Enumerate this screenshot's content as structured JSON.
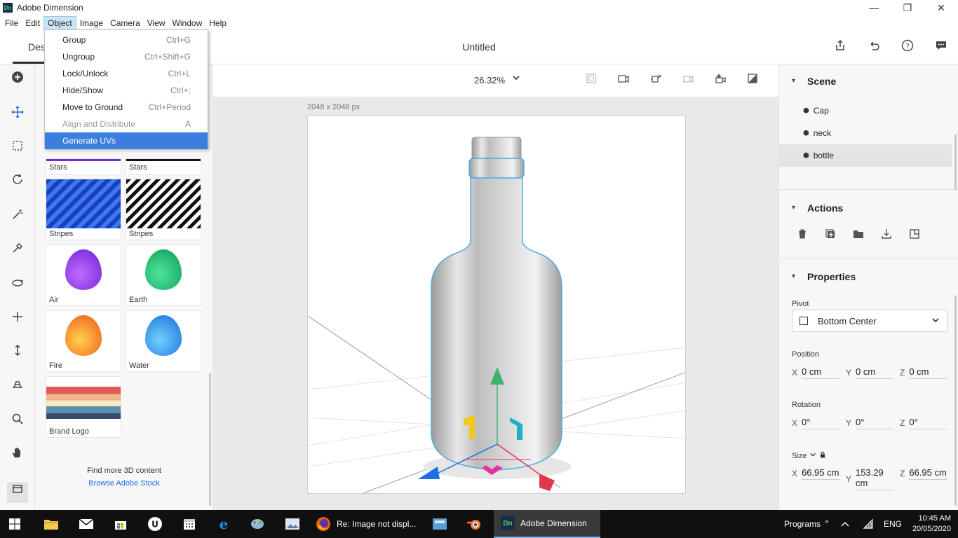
{
  "window": {
    "app_icon": "Dn",
    "title": "Adobe Dimension",
    "minimize": "—",
    "maximize": "❐",
    "close": "✕"
  },
  "menu": [
    "File",
    "Edit",
    "Object",
    "Image",
    "Camera",
    "View",
    "Window",
    "Help"
  ],
  "object_menu": [
    {
      "label": "Group",
      "shortcut": "Ctrl+G"
    },
    {
      "label": "Ungroup",
      "shortcut": "Ctrl+Shift+G"
    },
    {
      "label": "Lock/Unlock",
      "shortcut": "Ctrl+L"
    },
    {
      "label": "Hide/Show",
      "shortcut": "Ctrl+;"
    },
    {
      "label": "Move to Ground",
      "shortcut": "Ctrl+Period"
    },
    {
      "label": "Align and Distribute",
      "shortcut": "A"
    },
    {
      "label": "Generate UVs",
      "shortcut": ""
    }
  ],
  "header": {
    "tab_design": "Desi",
    "doc_title": "Untitled"
  },
  "assets": {
    "tiles": [
      {
        "label": "Stars"
      },
      {
        "label": "Stars"
      },
      {
        "label": "Stripes"
      },
      {
        "label": "Stripes"
      },
      {
        "label": "Air"
      },
      {
        "label": "Earth"
      },
      {
        "label": "Fire"
      },
      {
        "label": "Water"
      },
      {
        "label": "Brand Logo"
      }
    ],
    "find_more": "Find more 3D content",
    "browse": "Browse Adobe Stock"
  },
  "viewport": {
    "zoom": "26.32%",
    "canvas_size": "2048 x 2048 px"
  },
  "scene": {
    "title": "Scene",
    "items": [
      {
        "label": "Cap"
      },
      {
        "label": "neck"
      },
      {
        "label": "bottle"
      }
    ]
  },
  "actions": {
    "title": "Actions"
  },
  "properties": {
    "title": "Properties",
    "pivot_label": "Pivot",
    "pivot_value": "Bottom Center",
    "position_label": "Position",
    "position": {
      "x": "0 cm",
      "y": "0 cm",
      "z": "0 cm"
    },
    "rotation_label": "Rotation",
    "rotation": {
      "x": "0°",
      "y": "0°",
      "z": "0°"
    },
    "size_label": "Size",
    "size": {
      "x": "66.95 cm",
      "y": "153.29 cm",
      "z": "66.95 cm"
    },
    "axes": {
      "x": "X",
      "y": "Y",
      "z": "Z"
    }
  },
  "taskbar": {
    "firefox_label": "Re: Image not displ...",
    "dimension_label": "Adobe Dimension",
    "programs": "Programs",
    "lang": "ENG",
    "time": "10:45 AM",
    "date": "20/05/2020",
    "dn_icon": "Dn"
  },
  "colors": {
    "accent": "#1473e6",
    "menu_highlight": "#3c7ee0",
    "taskbar": "#101010"
  }
}
